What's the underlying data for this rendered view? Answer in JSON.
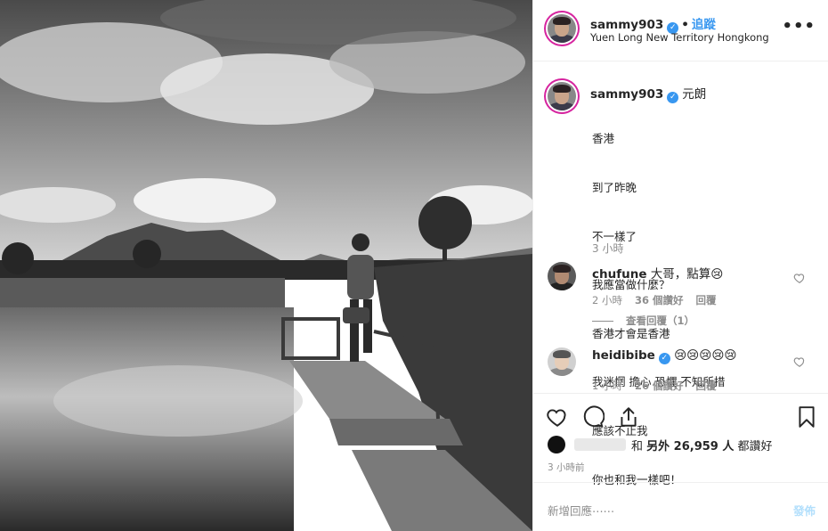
{
  "post": {
    "username": "sammy903",
    "follow_label": "追蹤",
    "location": "Yuen Long New Territory Hongkong",
    "more_label": "•••"
  },
  "caption": {
    "username": "sammy903",
    "location_tag": "元朗",
    "lines": [
      "香港",
      "到了昨晚",
      "不一樣了",
      "我應當做什麼？",
      "香港才會是香港",
      "我迷惘 擔心 恐懼 不知所措",
      "應該不止我",
      "你也和我一樣吧！"
    ],
    "time": "3 小時"
  },
  "comments": [
    {
      "username": "chufune",
      "text": "大哥，點算😢",
      "time": "2 小時",
      "likes": "36 個讚好",
      "reply": "回覆",
      "view_replies": "查看回覆（1）"
    },
    {
      "username": "heidibibe",
      "text": "😢😢😢😢😢",
      "time": "1 小時",
      "likes": "26 個讚好",
      "reply": "回覆"
    }
  ],
  "likes": {
    "and": "和",
    "others": "另外 26,959 人",
    "liked": "都讚好"
  },
  "post_time": "3 小時前",
  "comment_box": {
    "placeholder": "新增回應⋯⋯",
    "post_label": "發佈"
  },
  "colors": {
    "accent": "#3897f0",
    "muted": "#8e8e8e",
    "post_disabled": "#b2dffc"
  }
}
